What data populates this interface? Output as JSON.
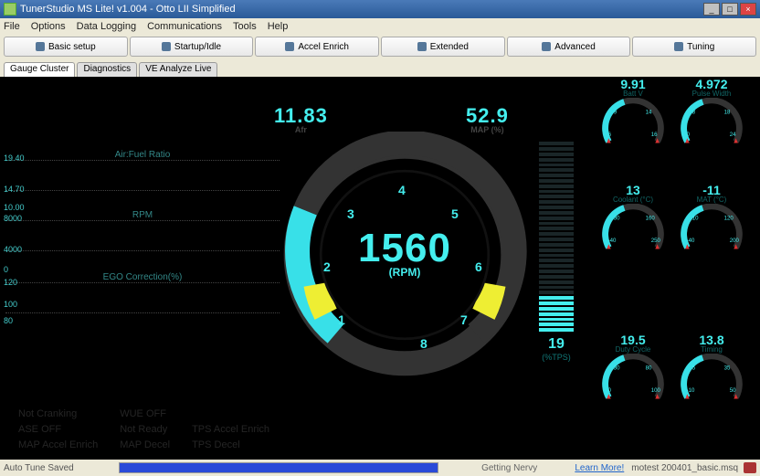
{
  "window": {
    "title": "TunerStudio MS Lite! v1.004 - Otto LII Simplified"
  },
  "menu": {
    "items": [
      "File",
      "Options",
      "Data Logging",
      "Communications",
      "Tools",
      "Help"
    ]
  },
  "toolbar": {
    "buttons": [
      "Basic setup",
      "Startup/Idle",
      "Accel Enrich",
      "Extended",
      "Advanced",
      "Tuning"
    ]
  },
  "tabs": {
    "items": [
      "Gauge Cluster",
      "Diagnostics",
      "VE Analyze Live"
    ],
    "active": 0
  },
  "afr": {
    "value": "11.83",
    "label": "Afr"
  },
  "map": {
    "value": "52.9",
    "label": "MAP (%)"
  },
  "rpm": {
    "value": "1560",
    "label": "(RPM)",
    "ticks": [
      "1",
      "2",
      "3",
      "4",
      "5",
      "6",
      "7",
      "8"
    ]
  },
  "tps": {
    "value": "19",
    "label": "(%TPS)",
    "fill_pct": 19
  },
  "strips": [
    {
      "title": "Air:Fuel Ratio",
      "top": "19.40",
      "bottom": "14.70"
    },
    {
      "title": "RPM",
      "top": "10.00",
      "bottom": "4000",
      "extra": "8000"
    },
    {
      "title": "EGO Correction(%)",
      "top": "120",
      "bottom": "80",
      "mid": "100"
    }
  ],
  "small_gauges": [
    {
      "value": "9.91",
      "label": "Batt V",
      "ticks": [
        "6",
        "9",
        "14",
        "16"
      ]
    },
    {
      "value": "4.972",
      "label": "Pulse Width",
      "ticks": [
        "0",
        "8",
        "18",
        "24"
      ]
    },
    {
      "value": "13",
      "label": "Coolant (°C)",
      "ticks": [
        "-40",
        "30",
        "160",
        "250"
      ]
    },
    {
      "value": "-11",
      "label": "MAT (°C)",
      "ticks": [
        "-40",
        "10",
        "120",
        "200"
      ]
    },
    {
      "value": "19.5",
      "label": "Duty Cycle",
      "ticks": [
        "0",
        "30",
        "80",
        "100"
      ]
    },
    {
      "value": "13.8",
      "label": "Timing",
      "ticks": [
        "-10",
        "5",
        "35",
        "50"
      ]
    }
  ],
  "status_inds": [
    [
      "Not Cranking",
      "WUE OFF",
      "",
      ""
    ],
    [
      "ASE OFF",
      "Not Ready",
      "TPS Accel Enrich",
      ""
    ],
    [
      "MAP Accel Enrich",
      "MAP Decel",
      "TPS Decel",
      ""
    ]
  ],
  "statusbar": {
    "msg": "Auto Tune Saved",
    "center": "Getting Nervy",
    "link": "Learn More!",
    "file": "motest 200401_basic.msq"
  },
  "colors": {
    "cyan": "#4ee",
    "darkcyan": "#177",
    "ring": "#333"
  }
}
